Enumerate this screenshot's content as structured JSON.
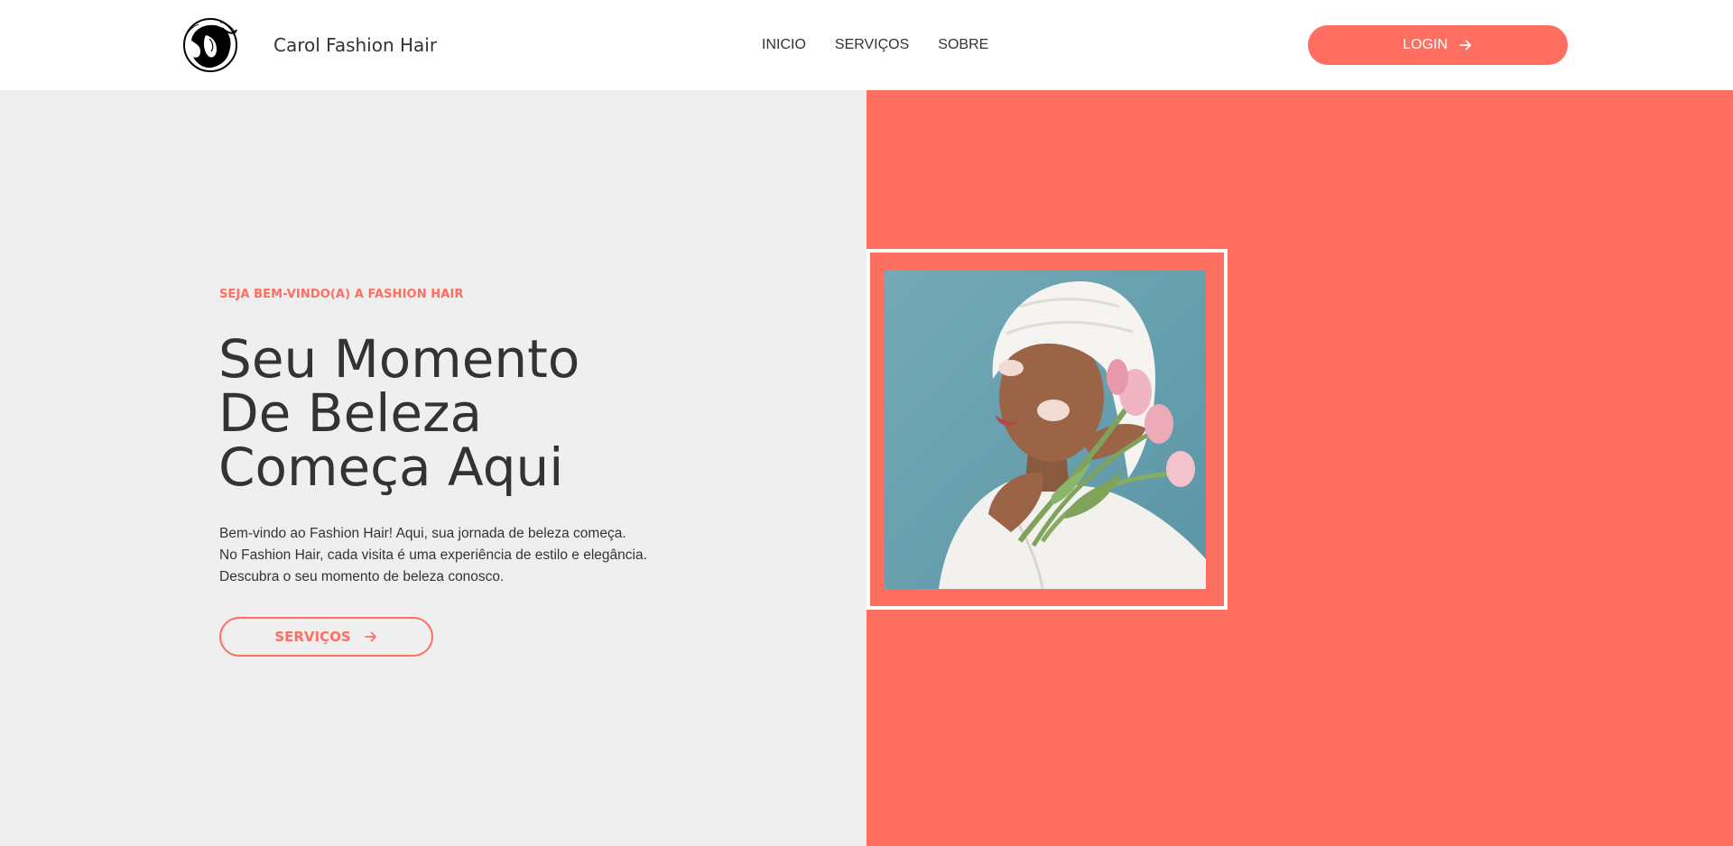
{
  "header": {
    "brand": "Carol Fashion Hair",
    "logo_icon": "woman-hair-logo-icon",
    "nav": [
      "INICIO",
      "SERVIÇOS",
      "SOBRE"
    ],
    "login_label": "LOGIN",
    "login_icon": "arrow-right-icon"
  },
  "hero": {
    "kicker": "SEJA BEM-VINDO(A) A FASHION HAIR",
    "headline_lines": [
      "Seu Momento",
      "De Beleza",
      "Começa Aqui"
    ],
    "description_lines": [
      "Bem-vindo ao Fashion Hair! Aqui, sua jornada de beleza começa.",
      "No Fashion Hair, cada visita é uma experiência de estilo e elegância.",
      "Descubra o seu momento de beleza conosco."
    ],
    "services_label": "SERVIÇOS",
    "services_icon": "arrow-right-icon",
    "photo_icon": "woman-with-towel-and-tulips-photo"
  },
  "colors": {
    "accent": "#ff6f61",
    "text": "#333333",
    "light_bg": "#efefef",
    "white": "#ffffff"
  }
}
